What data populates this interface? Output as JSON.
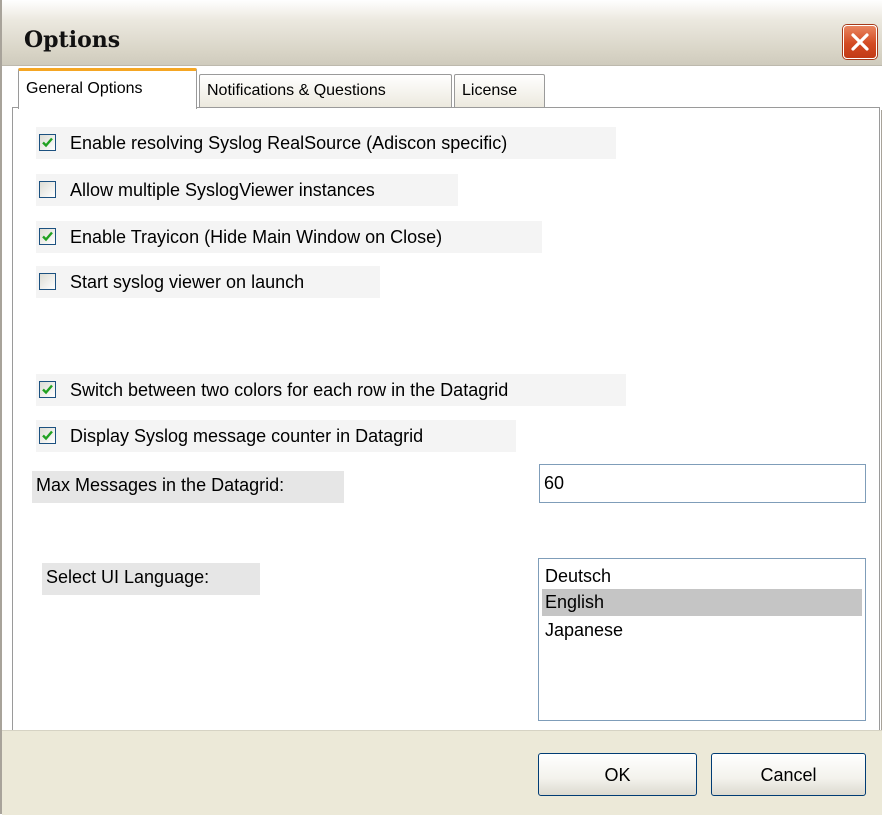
{
  "window": {
    "title": "Options"
  },
  "tabs": [
    {
      "label": "General Options",
      "active": true
    },
    {
      "label": "Notifications & Questions",
      "active": false
    },
    {
      "label": "License",
      "active": false
    }
  ],
  "checkboxes": [
    {
      "label": "Enable resolving Syslog RealSource (Adiscon specific)",
      "checked": true
    },
    {
      "label": "Allow multiple SyslogViewer instances",
      "checked": false
    },
    {
      "label": "Enable Trayicon (Hide Main Window on Close)",
      "checked": true
    },
    {
      "label": "Start syslog viewer on launch",
      "checked": false
    },
    {
      "label": "Switch between two colors for each row in the Datagrid",
      "checked": true
    },
    {
      "label": "Display Syslog message counter in Datagrid",
      "checked": true
    }
  ],
  "max_messages": {
    "label": "Max Messages in the Datagrid:",
    "value": "60"
  },
  "language": {
    "label": "Select UI Language:",
    "options": [
      "Deutsch",
      "English",
      "Japanese"
    ],
    "selected": "English"
  },
  "buttons": {
    "ok": "OK",
    "cancel": "Cancel"
  },
  "colors": {
    "accent_tab": "#f5a623",
    "close_red": "#d34a22",
    "selection": "#c5c5c5"
  }
}
